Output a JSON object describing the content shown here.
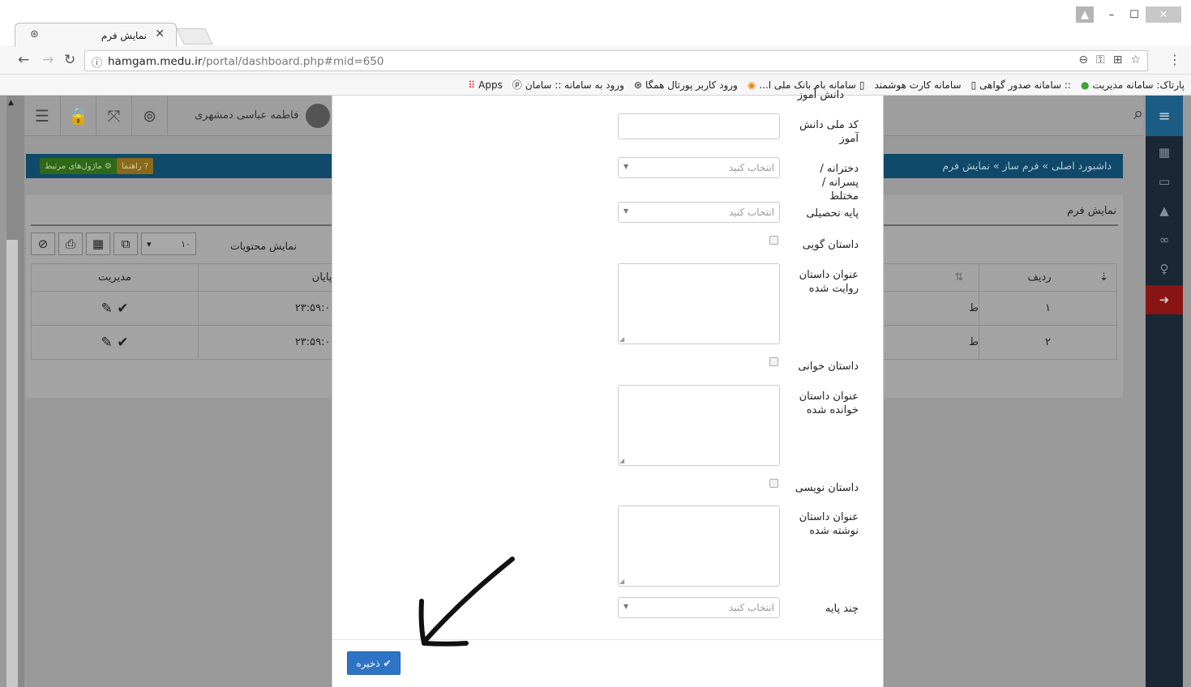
{
  "browser": {
    "tab_title": "نمایش فرم",
    "url_host": "hamgam.medu.ir",
    "url_path": "/portal/dashboard.php#mid=650",
    "bookmarks": [
      "پارتاک: سامانه مدیریت",
      ":: سامانه صدور گواهی",
      "سامانه کارت هوشمند",
      "سامانه بام بانک ملی ا...",
      "ورود کاربر پورتال همگا",
      "ورود به سامانه :: سامان",
      "Apps"
    ]
  },
  "topbar": {
    "user_name": "فاطمه عباسی دمشهری"
  },
  "breadcrumb": {
    "text": "داشبورد اصلی » فرم ساز » نمایش فرم",
    "guide_label": "راهنما",
    "modules_label": "ماژول‌های مرتبط"
  },
  "panel": {
    "title": "نمایش فرم",
    "show_items_label": "نمایش محتویات",
    "page_size": "۱۰",
    "columns": {
      "manage": "مدیریت",
      "end": "پایان",
      "row": "ردیف"
    },
    "rows": [
      {
        "row": "۱",
        "end": "۲۳:۵۹:۰",
        "mid": "ط"
      },
      {
        "row": "۲",
        "end": "۲۳:۵۹:۰",
        "mid": "ط"
      }
    ]
  },
  "modal": {
    "cut_label": "دانش آموز",
    "fields": {
      "national_code": "کد ملی دانش آموز",
      "gender": "دخترانه / پسرانه / مختلط",
      "grade": "پایه تحصیلی",
      "story_telling": "داستان گویی",
      "told_story_title": "عنوان داستان روایت شده",
      "story_reading": "داستان خوانی",
      "read_story_title": "عنوان داستان خوانده شده",
      "story_writing": "داستان نویسی",
      "written_story_title": "عنوان داستان نوشته شده",
      "multi_grade": "چند پایه"
    },
    "select_placeholder": "انتخاب کنید",
    "save_label": "ذخیره"
  }
}
